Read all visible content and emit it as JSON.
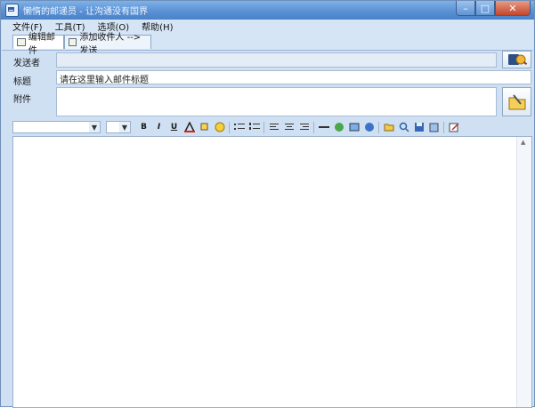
{
  "window": {
    "title": "懒惰的邮递员 - 让沟通没有国界"
  },
  "window_buttons": {
    "minimize": "–",
    "maximize": "□",
    "close": "✕"
  },
  "menu": [
    {
      "label": "文件(F)"
    },
    {
      "label": "工具(T)"
    },
    {
      "label": "选项(O)"
    },
    {
      "label": "帮助(H)"
    }
  ],
  "tabs": [
    {
      "label": "编辑邮件"
    },
    {
      "label": "添加收件人 --> 发送"
    }
  ],
  "form": {
    "sender_label": "发送者",
    "sender_value": "",
    "subject_label": "标题",
    "subject_value": "请在这里输入邮件标题",
    "attachment_label": "附件",
    "attachment_value": ""
  },
  "format_toolbar": {
    "font_value": "",
    "size_value": "",
    "bold": "B",
    "italic": "I",
    "underline": "U"
  },
  "colors": {
    "titlebar": "#5a91d4",
    "frame": "#cfe0f3",
    "field_border": "#a9bcd6"
  }
}
